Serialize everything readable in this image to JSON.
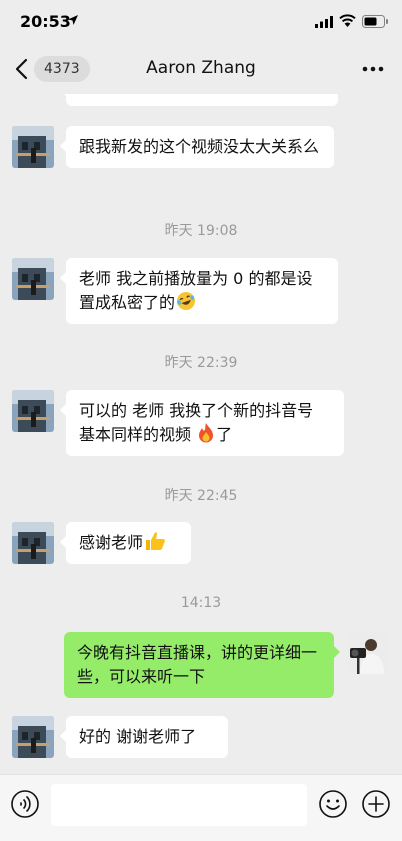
{
  "status_bar": {
    "time": "20:53"
  },
  "nav": {
    "back_count": "4373",
    "title": "Aaron Zhang"
  },
  "messages": [
    {
      "text": "跟我新发的这个视频没太大关系么"
    },
    {
      "text_before": "老师 我之前播放量为 0 的都是设置成私密了的",
      "emoji": "laughing-tears-emoji"
    },
    {
      "text_before": "可以的 老师 我换了个新的抖音号 基本同样的视频 ",
      "emoji": "fire-emoji",
      "text_after": "了"
    },
    {
      "text_before": "感谢老师",
      "emoji": "thumbs-up-emoji"
    },
    {
      "text": "今晚有抖音直播课，讲的更详细一些，可以来听一下"
    },
    {
      "text": "好的 谢谢老师了"
    }
  ],
  "timestamps": [
    "昨天 19:08",
    "昨天 22:39",
    "昨天 22:45",
    "14:13"
  ],
  "colors": {
    "background": "#ededed",
    "left_bubble": "#ffffff",
    "right_bubble": "#95ec69",
    "timestamp_text": "#9a9a9a"
  },
  "icons": {
    "status": [
      "location-arrow-icon",
      "signal-icon",
      "wifi-icon",
      "battery-icon"
    ],
    "nav": [
      "back-chevron-icon",
      "more-icon"
    ],
    "input": [
      "voice-icon",
      "emoji-icon",
      "plus-icon"
    ]
  }
}
